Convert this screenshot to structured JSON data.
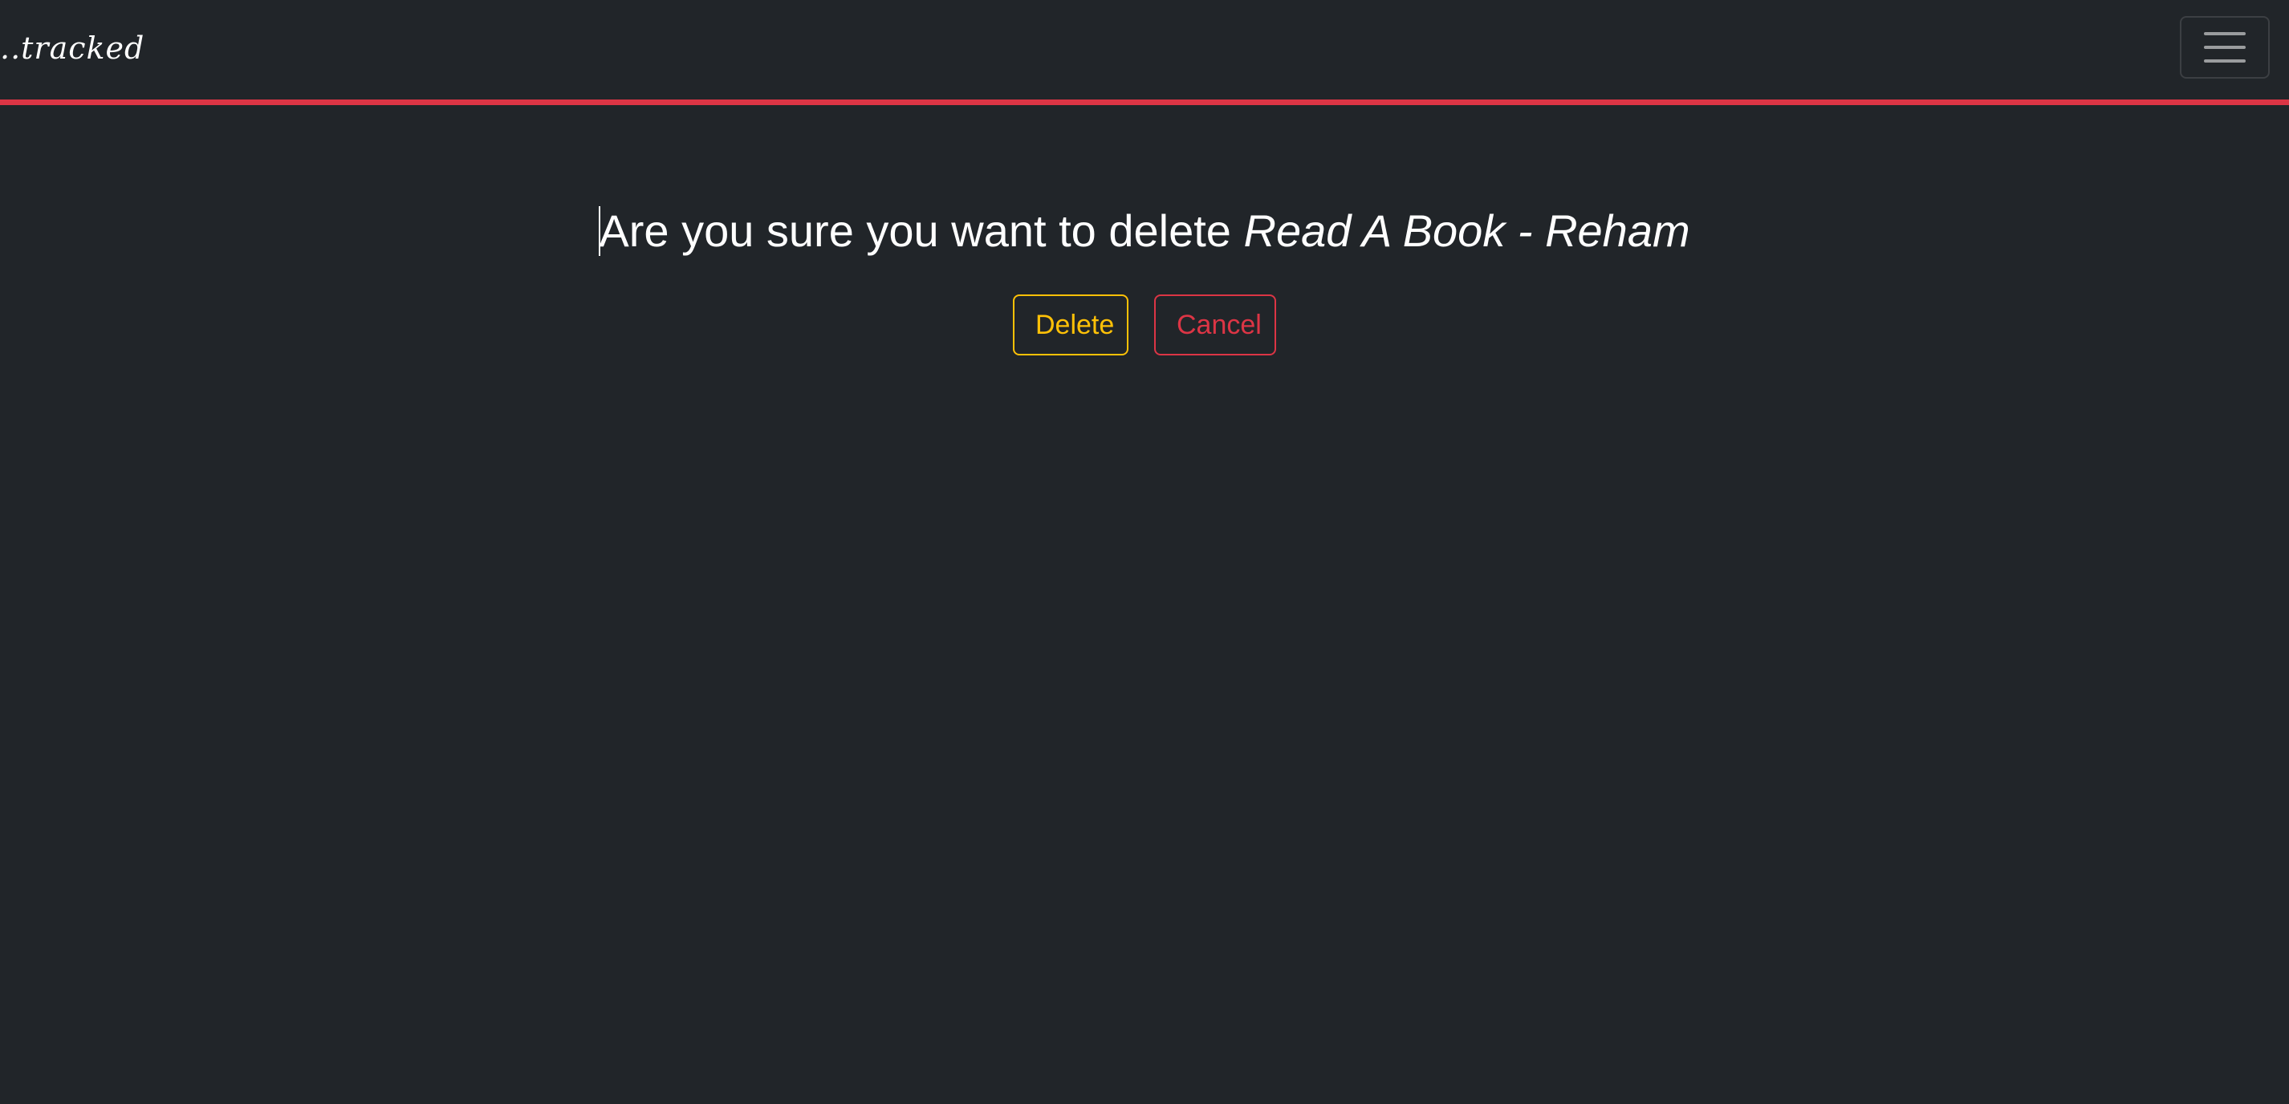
{
  "navbar": {
    "brand": "..tracked",
    "toggler_icon": "hamburger-menu-icon",
    "accent_color": "#dc3545",
    "background_color": "#212529"
  },
  "confirm": {
    "question": "Are you sure you want to delete ",
    "item_name": "Read A Book - Reham"
  },
  "actions": {
    "delete_label": "Delete",
    "delete_color": "#ffc107",
    "cancel_label": "Cancel",
    "cancel_color": "#dc3545"
  }
}
